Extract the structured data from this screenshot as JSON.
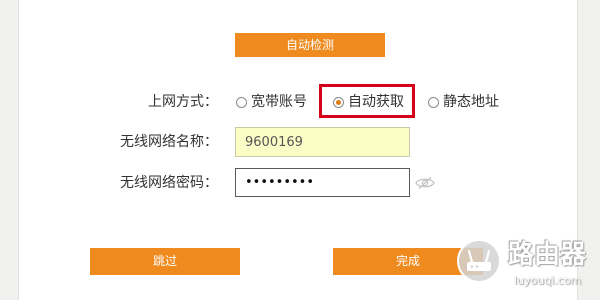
{
  "auto_detect_button": {
    "label": "自动检测"
  },
  "connection_type": {
    "label": "上网方式：",
    "options": [
      {
        "label": "宽带账号",
        "selected": false
      },
      {
        "label": "自动获取",
        "selected": true
      },
      {
        "label": "静态地址",
        "selected": false
      }
    ]
  },
  "wifi_name": {
    "label": "无线网络名称：",
    "value": "9600169"
  },
  "wifi_password": {
    "label": "无线网络密码：",
    "value": "•••••••••",
    "toggle_icon": "eye-slash-icon"
  },
  "skip_button": {
    "label": "跳过"
  },
  "finish_button": {
    "label": "完成"
  },
  "watermark": {
    "brand": "路由器",
    "url": "luyouqi.com",
    "logo_icon": "router-logo-icon"
  },
  "colors": {
    "accent": "#ee8a1e",
    "highlight_box": "#d7001a",
    "name_input_bg": "#fcfcc6",
    "panel_bg": "#ffffff",
    "side_bg": "#f1f1ef"
  }
}
